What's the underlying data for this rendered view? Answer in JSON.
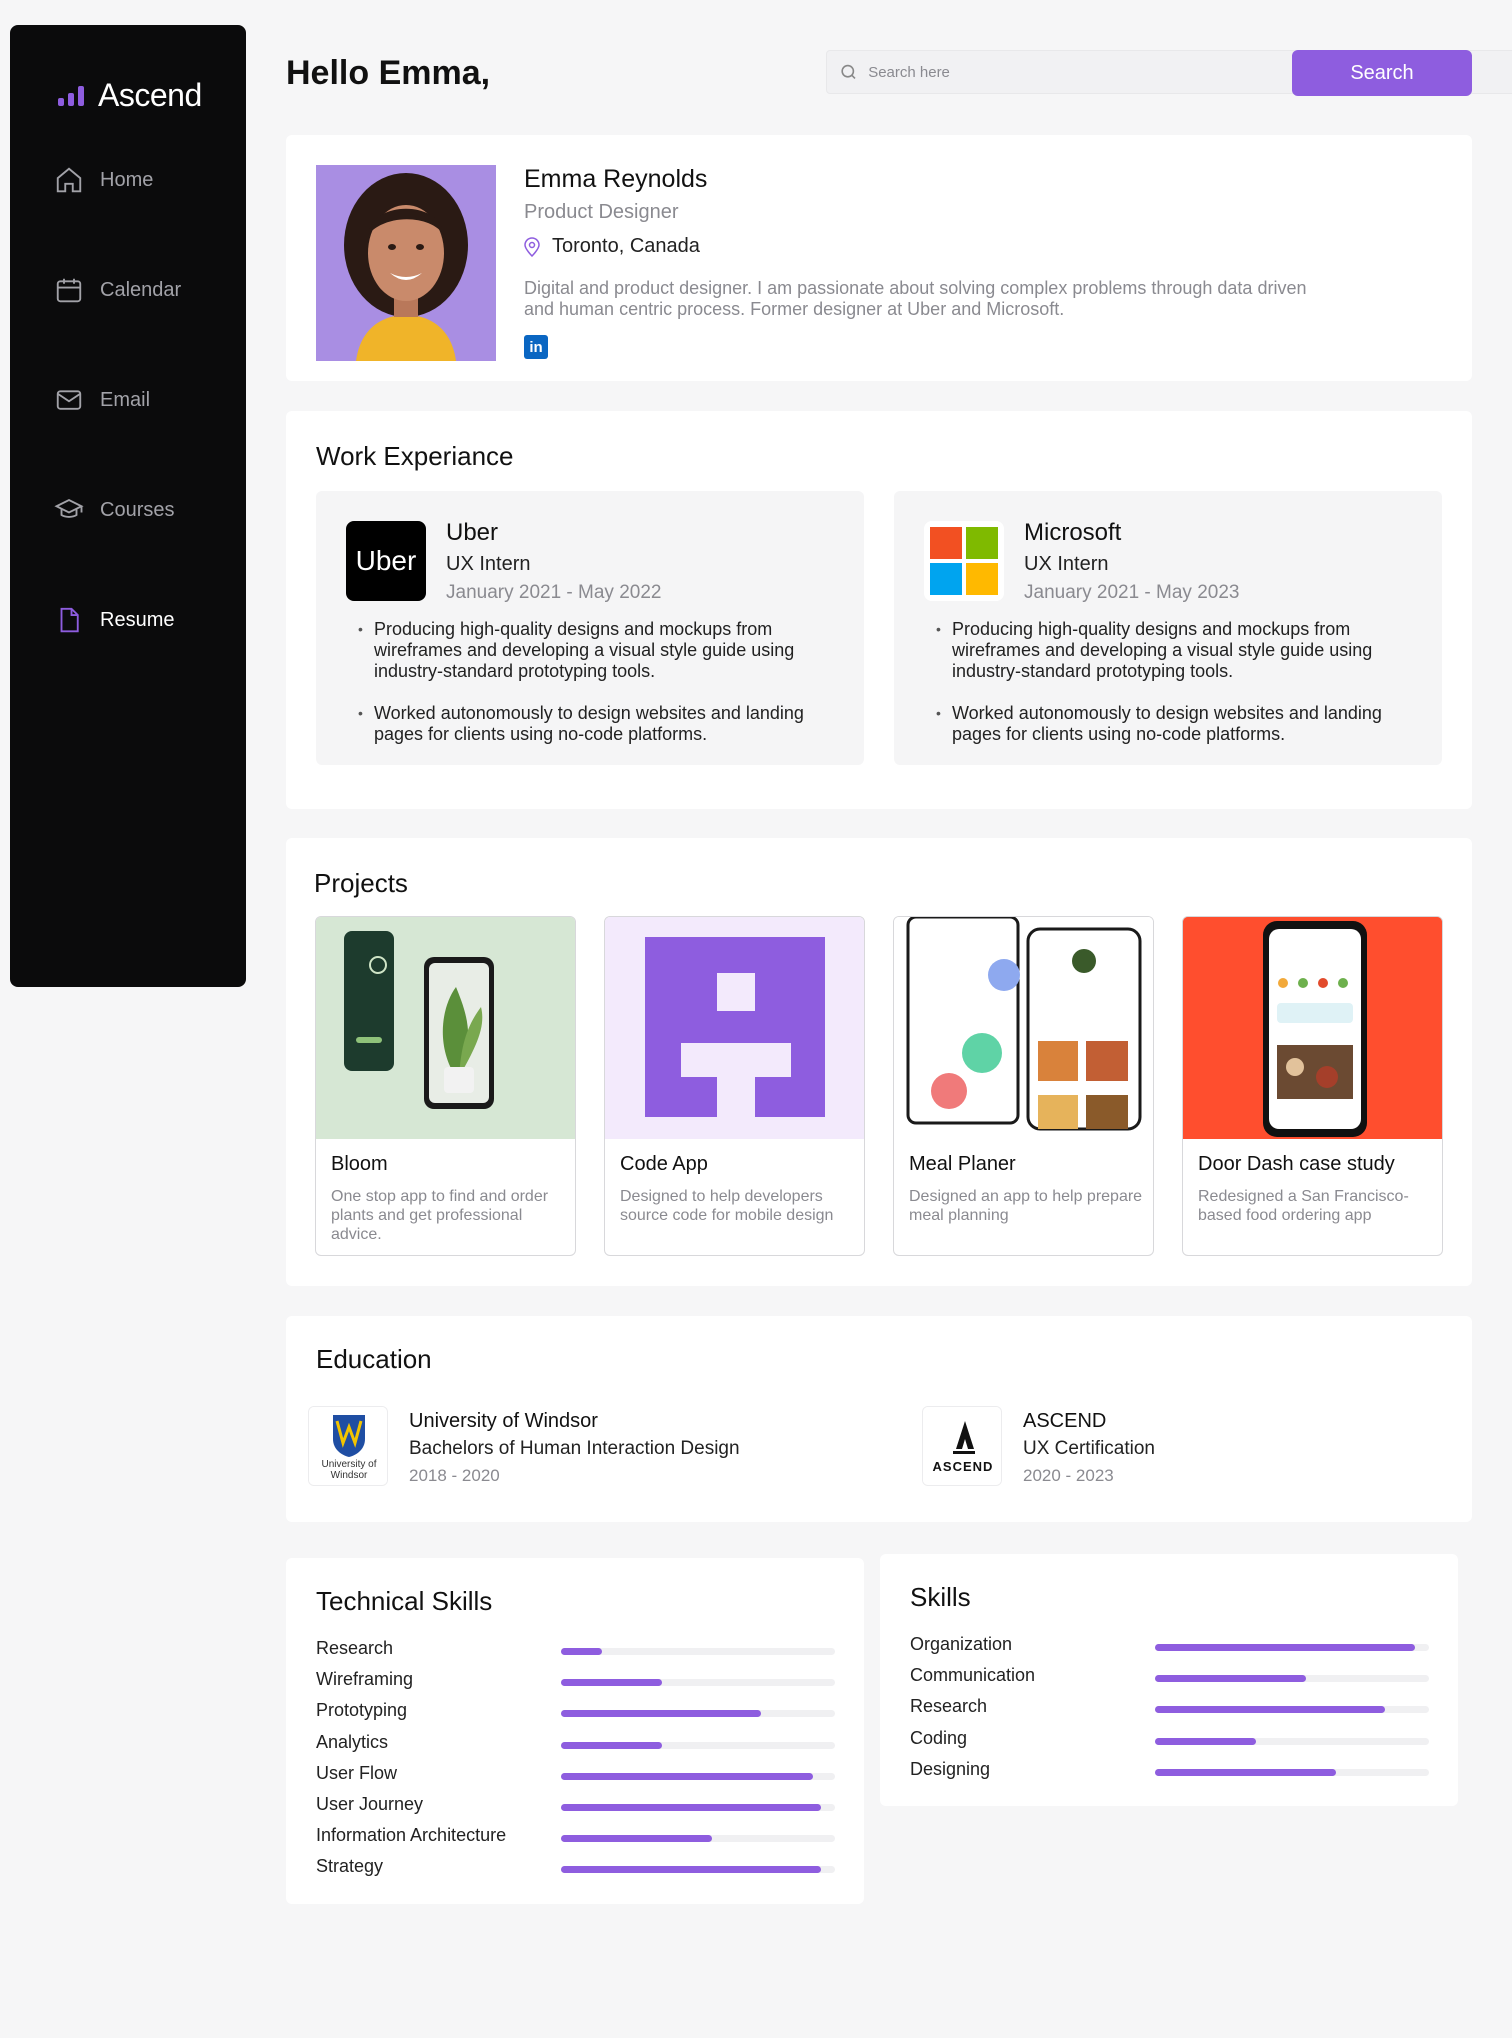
{
  "colors": {
    "accent": "#8e5ddf",
    "sidebar_bg": "#0b0b0c",
    "page_bg": "#f6f6f7"
  },
  "app": {
    "name": "Ascend"
  },
  "nav": [
    {
      "label": "Home",
      "icon": "home-icon",
      "active": false
    },
    {
      "label": "Calendar",
      "icon": "calendar-icon",
      "active": false
    },
    {
      "label": "Email",
      "icon": "mail-icon",
      "active": false
    },
    {
      "label": "Courses",
      "icon": "graduation-cap-icon",
      "active": false
    },
    {
      "label": "Resume",
      "icon": "document-icon",
      "active": true
    }
  ],
  "header": {
    "greeting": "Hello Emma,",
    "search_placeholder": "Search here",
    "search_button": "Search"
  },
  "profile": {
    "name": "Emma Reynolds",
    "title": "Product Designer",
    "location": "Toronto, Canada",
    "bio": "Digital and product designer. I am passionate about solving complex problems through data driven and human centric process. Former designer at Uber and Microsoft.",
    "social_icon": "linkedin-icon",
    "social_text": "in"
  },
  "experience": {
    "title": "Work Experiance",
    "items": [
      {
        "company": "Uber",
        "logo_text": "Uber",
        "role": "UX Intern",
        "dates": "January 2021 - May 2022",
        "bullets": [
          "Producing high-quality designs and mockups from wireframes and developing a visual style guide using industry-standard prototyping tools.",
          "Worked autonomously to design websites and landing pages for clients using no-code platforms."
        ]
      },
      {
        "company": "Microsoft",
        "role": "UX Intern",
        "dates": "January 2021 - May 2023",
        "bullets": [
          "Producing high-quality designs and mockups from wireframes and developing a visual style guide using industry-standard prototyping tools.",
          "Worked autonomously to design websites and landing pages for clients using no-code platforms."
        ]
      }
    ]
  },
  "projects": {
    "title": "Projects",
    "items": [
      {
        "title": "Bloom",
        "desc": "One stop app to find and order plants and get professional advice."
      },
      {
        "title": "Code App",
        "desc": "Designed to help developers source code for mobile design"
      },
      {
        "title": "Meal Planer",
        "desc": "Designed an app to help prepare meal planning"
      },
      {
        "title": "Door Dash case study",
        "desc": "Redesigned a San Francisco-based food ordering app"
      }
    ]
  },
  "education": {
    "title": "Education",
    "items": [
      {
        "school": "University of Windsor",
        "degree": "Bachelors of Human Interaction Design",
        "years": "2018 - 2020",
        "logo_text": "University of Windsor"
      },
      {
        "school": "ASCEND",
        "degree": "UX Certification",
        "years": "2020 - 2023",
        "logo_text": "ASCEND"
      }
    ]
  },
  "technical_skills": {
    "title": "Technical Skills",
    "items": [
      {
        "label": "Research",
        "level": 0.15
      },
      {
        "label": "Wireframing",
        "level": 0.37
      },
      {
        "label": "Prototyping",
        "level": 0.73
      },
      {
        "label": "Analytics",
        "level": 0.37
      },
      {
        "label": "User Flow",
        "level": 0.92
      },
      {
        "label": "User Journey",
        "level": 0.95
      },
      {
        "label": "Information Architecture",
        "level": 0.55
      },
      {
        "label": "Strategy",
        "level": 0.95
      }
    ]
  },
  "skills": {
    "title": "Skills",
    "items": [
      {
        "label": "Organization",
        "level": 0.95
      },
      {
        "label": "Communication",
        "level": 0.55
      },
      {
        "label": "Research",
        "level": 0.84
      },
      {
        "label": "Coding",
        "level": 0.37
      },
      {
        "label": "Designing",
        "level": 0.66
      }
    ]
  }
}
